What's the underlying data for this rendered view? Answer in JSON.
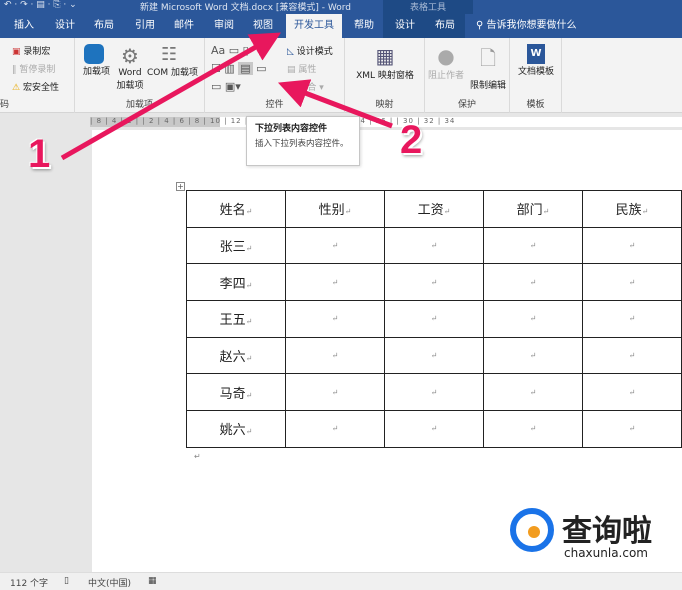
{
  "title_bar": {
    "quick_access": "↶ · ↷ · ▤ · ⎘ ·  ⌄",
    "title": "新建 Microsoft Word 文档.docx [兼容模式] - Word",
    "context": "表格工具"
  },
  "tabs": [
    "插入",
    "设计",
    "布局",
    "引用",
    "邮件",
    "审阅",
    "视图",
    "开发工具",
    "帮助",
    "设计",
    "布局"
  ],
  "active_tab": "开发工具",
  "search_placeholder": "告诉我你想要做什么",
  "ribbon": {
    "code": {
      "label": "码",
      "items": [
        "录制宏",
        "暂停录制",
        "宏安全性"
      ]
    },
    "addins": {
      "label": "加载项",
      "items": [
        "加载项",
        "Word 加载项",
        "COM 加载项"
      ]
    },
    "controls": {
      "label": "控件",
      "design_mode": "设计模式",
      "properties": "属性",
      "group": "组合"
    },
    "mapping": {
      "label": "映射",
      "item": "XML 映射窗格"
    },
    "protect": {
      "label": "保护",
      "items": [
        "阻止作者",
        "限制编辑"
      ]
    },
    "templates": {
      "label": "模板",
      "item": "文档模板"
    }
  },
  "ruler": "| 8 | 4 | 2 |  | 2 |  4 |  6 |  8 | 10 | 12 | 14 | 16 | 18 | 20 |  22 | 24 | 26 |   | 30 | 32 | 34",
  "tooltip": {
    "title": "下拉列表内容控件",
    "description": "插入下拉列表内容控件。"
  },
  "table": {
    "headers": [
      "姓名",
      "性别",
      "工资",
      "部门",
      "民族"
    ],
    "names": [
      "张三",
      "李四",
      "王五",
      "赵六",
      "马奇",
      "姚六"
    ],
    "mark": "↵"
  },
  "annotations": {
    "one": "1",
    "two": "2"
  },
  "status": {
    "words": "112 个字",
    "lang": "中文(中国)"
  },
  "watermark": {
    "name": "查询啦",
    "url": "chaxunla.com"
  },
  "colors": {
    "accent": "#2b579a",
    "arrow": "#e8175d"
  }
}
